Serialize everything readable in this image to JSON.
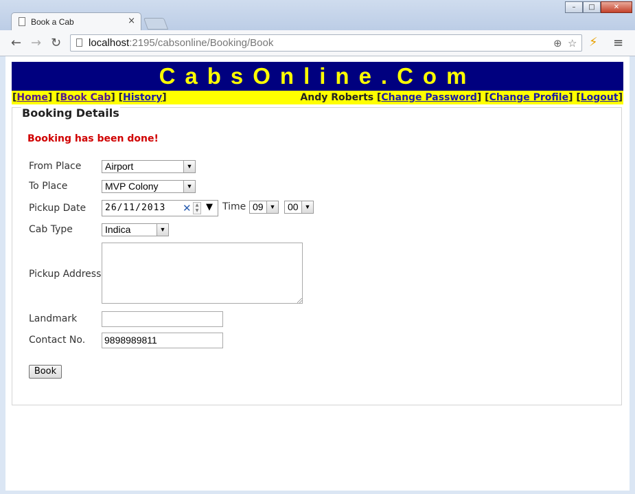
{
  "browser": {
    "tab_title": "Book a Cab",
    "tab_close": "×",
    "url_host": "localhost",
    "url_rest": ":2195/cabsonline/Booking/Book",
    "window_buttons": {
      "minimize": "–",
      "maximize": "□",
      "close": "✕"
    },
    "nav": {
      "back": "←",
      "forward": "→",
      "reload": "↻"
    },
    "omni_icons": {
      "zoom": "⊕",
      "star": "☆"
    },
    "extension_icon": "⚡",
    "menu_icon": "≡"
  },
  "site": {
    "banner": "CabsOnline.Com",
    "nav_left": [
      "Home",
      "Book Cab",
      "History"
    ],
    "user_name": "Andy Roberts",
    "nav_right": [
      "Change Password",
      "Change Profile",
      "Logout"
    ]
  },
  "form": {
    "legend": "Booking Details",
    "status_message": "Booking has been done!",
    "from_label": "From Place",
    "from_value": "Airport",
    "to_label": "To Place",
    "to_value": "MVP Colony",
    "date_label": "Pickup Date",
    "date_value": "26/11/2013",
    "time_label": "Time",
    "hour_value": "09",
    "minute_value": "00",
    "cabtype_label": "Cab Type",
    "cabtype_value": "Indica",
    "address_label": "Pickup Address",
    "address_value": "",
    "landmark_label": "Landmark",
    "landmark_value": "",
    "contact_label": "Contact No.",
    "contact_value": "9898989811",
    "submit_label": "Book"
  },
  "colors": {
    "banner_bg": "#00007f",
    "banner_text": "#ffff00",
    "navbar_bg": "#ffff00",
    "status_text": "#d00000"
  }
}
